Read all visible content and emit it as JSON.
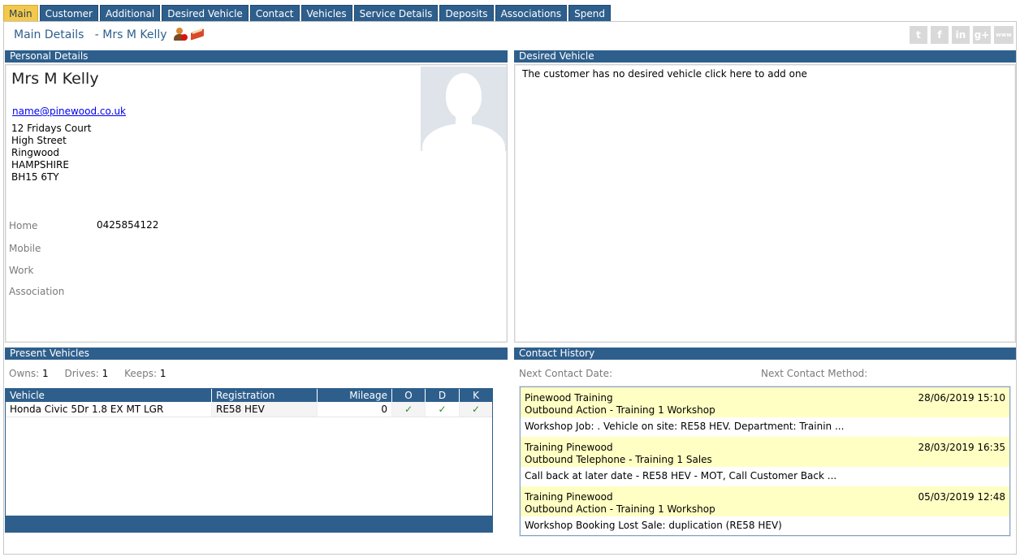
{
  "tabs": [
    {
      "label": "Main",
      "active": true
    },
    {
      "label": "Customer"
    },
    {
      "label": "Additional"
    },
    {
      "label": "Desired Vehicle"
    },
    {
      "label": "Contact"
    },
    {
      "label": "Vehicles"
    },
    {
      "label": "Service Details"
    },
    {
      "label": "Deposits"
    },
    {
      "label": "Associations"
    },
    {
      "label": "Spend"
    }
  ],
  "header": {
    "title": "Main Details",
    "customer": "- Mrs M Kelly",
    "icons": [
      "user-warning-icon",
      "book-icon"
    ],
    "social": [
      {
        "icon": "twitter-icon",
        "glyph": "t"
      },
      {
        "icon": "facebook-icon",
        "glyph": "f"
      },
      {
        "icon": "linkedin-icon",
        "glyph": "in"
      },
      {
        "icon": "google-plus-icon",
        "glyph": "g+"
      },
      {
        "icon": "web-icon",
        "glyph": "www"
      }
    ]
  },
  "personal": {
    "heading": "Personal Details",
    "name": "Mrs M Kelly",
    "email": "name@pinewood.co.uk",
    "address": [
      "12 Fridays Court",
      "High Street",
      "Ringwood",
      "HAMPSHIRE",
      "BH15 6TY"
    ],
    "phones": [
      {
        "label": "Home",
        "value": "0425854122"
      },
      {
        "label": "Mobile",
        "value": ""
      },
      {
        "label": "Work",
        "value": ""
      },
      {
        "label": "Association",
        "value": ""
      }
    ]
  },
  "desired": {
    "heading": "Desired Vehicle",
    "message": "The customer has no desired vehicle click here to add one"
  },
  "present": {
    "heading": "Present Vehicles",
    "owns_label": "Owns:",
    "owns": "1",
    "drives_label": "Drives:",
    "drives": "1",
    "keeps_label": "Keeps:",
    "keeps": "1",
    "columns": [
      "Vehicle",
      "Registration",
      "Mileage",
      "O",
      "D",
      "K"
    ],
    "rows": [
      {
        "vehicle": "Honda Civic 5Dr 1.8 EX MT LGR",
        "registration": "RE58 HEV",
        "mileage": "0",
        "o": "✓",
        "d": "✓",
        "k": "✓"
      }
    ]
  },
  "contact": {
    "heading": "Contact History",
    "next_date_label": "Next Contact Date:",
    "next_method_label": "Next Contact Method:",
    "items": [
      {
        "who": "Pinewood Training",
        "action": "Outbound Action - Training 1 Workshop",
        "datetime": "28/06/2019 15:10",
        "note": "Workshop Job: . Vehicle on site: RE58 HEV. Department: Trainin ..."
      },
      {
        "who": "Training Pinewood",
        "action": "Outbound Telephone - Training 1 Sales",
        "datetime": "28/03/2019 16:35",
        "note": "Call back at later date - RE58 HEV - MOT, Call Customer Back ..."
      },
      {
        "who": "Training Pinewood",
        "action": "Outbound Action - Training 1 Workshop",
        "datetime": "05/03/2019 12:48",
        "note": "Workshop Booking Lost Sale: duplication (RE58 HEV)"
      }
    ]
  },
  "colors": {
    "accent": "#2e5f8c",
    "active_tab": "#f2c94c",
    "history_highlight": "#ffffc4"
  }
}
